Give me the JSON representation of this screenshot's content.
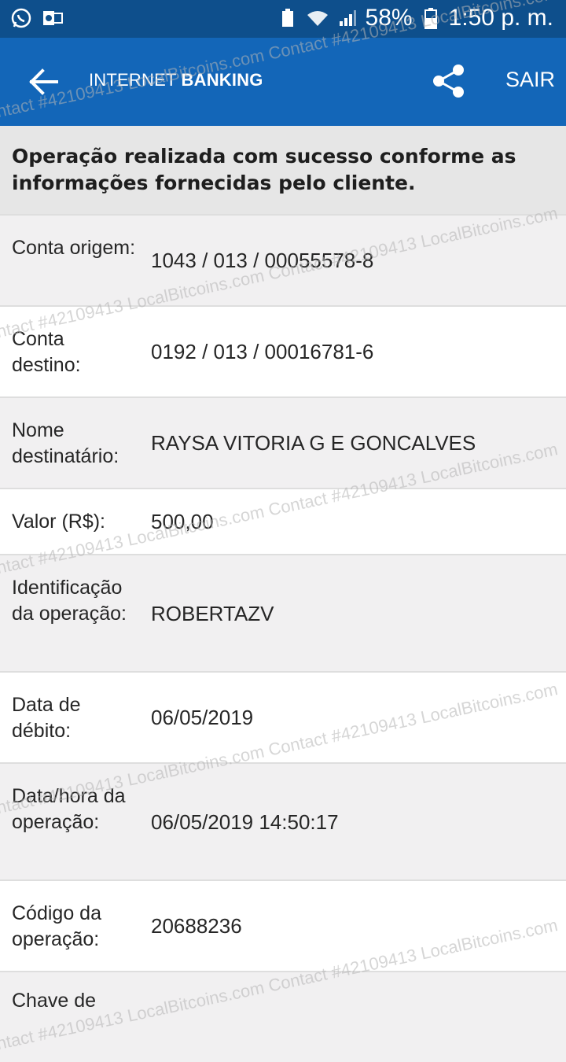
{
  "status_bar": {
    "battery": "58%",
    "time": "1:50 p. m."
  },
  "header": {
    "title_light": "INTERNET",
    "title_bold": "BANKING",
    "exit_label": "SAIR"
  },
  "message": "Operação realizada com sucesso conforme as informações fornecidas pelo cliente.",
  "rows": [
    {
      "label": "Conta origem:",
      "value": "1043 / 013 / 00055578-8"
    },
    {
      "label": "Conta destino:",
      "value": "0192 / 013 / 00016781-6"
    },
    {
      "label": "Nome destinatário:",
      "value": "RAYSA VITORIA G E GONCALVES"
    },
    {
      "label": "Valor (R$):",
      "value": "500,00"
    },
    {
      "label": "Identificação da operação:",
      "value": "ROBERTAZV"
    },
    {
      "label": "Data de débito:",
      "value": "06/05/2019"
    },
    {
      "label": "Data/hora da operação:",
      "value": "06/05/2019 14:50:17"
    },
    {
      "label": "Código da operação:",
      "value": "20688236"
    },
    {
      "label": "Chave de",
      "value": ""
    }
  ],
  "watermark": "Contact #42109413  LocalBitcoins.com  Contact #42109413  LocalBitcoins.com"
}
